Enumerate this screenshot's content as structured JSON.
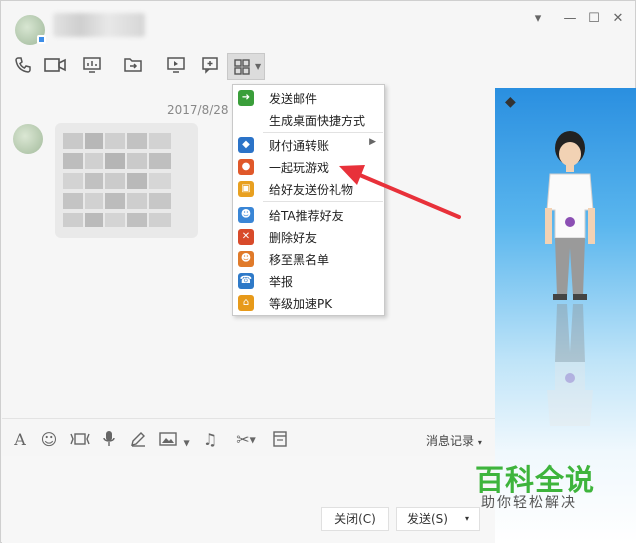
{
  "window": {
    "controls": {
      "pin": "▾",
      "minimize": "—",
      "maximize": "☐",
      "close": "✕"
    }
  },
  "toolbar": {
    "icons": [
      "phone-icon",
      "video-icon",
      "screen-share-icon",
      "file-transfer-icon",
      "remote-assist-icon",
      "add-chat-icon",
      "apps-grid-icon"
    ]
  },
  "chat": {
    "date_label": "2017/8/28"
  },
  "context_menu": {
    "items": [
      {
        "label": "发送邮件",
        "icon": "mail-send-icon",
        "color": "#3a9e3a"
      },
      {
        "label": "生成桌面快捷方式",
        "icon": "",
        "color": ""
      },
      {
        "label": "财付通转账",
        "icon": "tenpay-icon",
        "color": "#2b73c8",
        "submenu": "▶"
      },
      {
        "label": "一起玩游戏",
        "icon": "game-icon",
        "color": "#e0582a"
      },
      {
        "label": "给好友送份礼物",
        "icon": "gift-icon",
        "color": "#e8a020"
      },
      {
        "label": "给TA推荐好友",
        "icon": "recommend-friend-icon",
        "color": "#3a86d6"
      },
      {
        "label": "删除好友",
        "icon": "delete-friend-icon",
        "color": "#d84a2a"
      },
      {
        "label": "移至黑名单",
        "icon": "blacklist-icon",
        "color": "#e07a2a"
      },
      {
        "label": "举报",
        "icon": "report-icon",
        "color": "#2f7ac8"
      },
      {
        "label": "等级加速PK",
        "icon": "level-pk-icon",
        "color": "#e79a1a"
      }
    ]
  },
  "input_toolbar": {
    "message_history_label": "消息记录",
    "caret": "▾"
  },
  "buttons": {
    "close_label": "关闭(C)",
    "send_label": "发送(S)",
    "send_dropdown": "▾"
  },
  "watermark": {
    "title": "百科全说",
    "subtitle": "助你轻松解决"
  },
  "colors": {
    "accent_arrow": "#e8313a",
    "watermark_green": "#3eb43c"
  }
}
